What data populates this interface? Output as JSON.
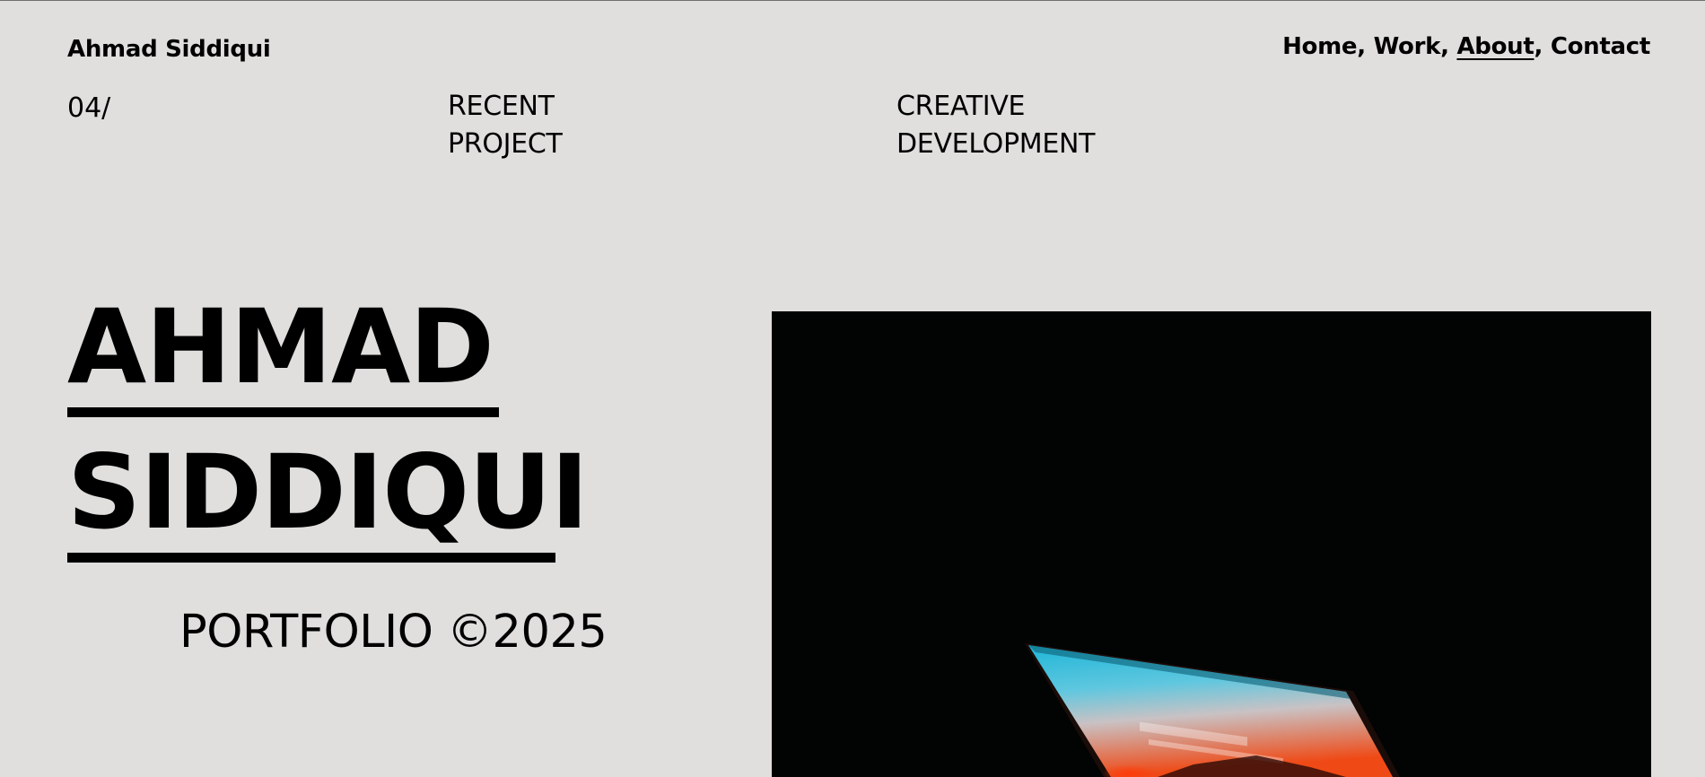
{
  "header": {
    "brand": "Ahmad Siddiqui",
    "nav": [
      {
        "label": "Home",
        "active": false
      },
      {
        "label": "Work",
        "active": false
      },
      {
        "label": "About",
        "active": true
      },
      {
        "label": "Contact",
        "active": false
      }
    ],
    "separator": ", "
  },
  "meta": {
    "counter": "04/",
    "col1": [
      "RECENT",
      "PROJECT"
    ],
    "col2": [
      "CREATIVE",
      "DEVELOPMENT"
    ]
  },
  "hero": {
    "first_name": "AHMAD",
    "last_name": "SIDDIQUI",
    "caption": "PORTFOLIO ©2025"
  },
  "photo": {
    "subject": "laptop-screen-glow-in-dark",
    "colors": {
      "background": "#020303",
      "screen_top": "#1fb6d8",
      "screen_mid": "#c9c2c4",
      "screen_bottom": "#ef4a16"
    }
  }
}
